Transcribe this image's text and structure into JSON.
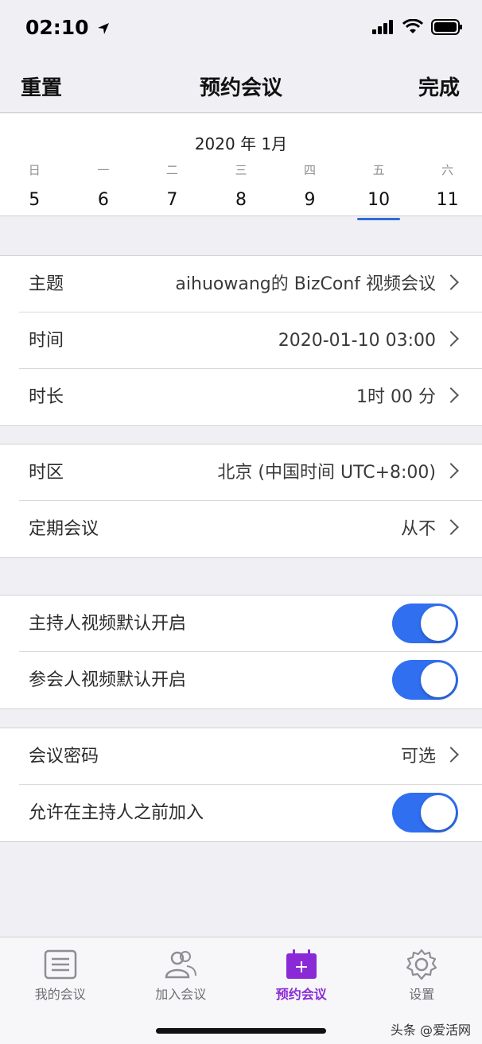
{
  "status": {
    "time": "02:10"
  },
  "nav": {
    "reset": "重置",
    "title": "预约会议",
    "done": "完成"
  },
  "calendar": {
    "month": "2020 年 1月",
    "weekdays": [
      "日",
      "一",
      "二",
      "三",
      "四",
      "五",
      "六"
    ],
    "days": [
      "5",
      "6",
      "7",
      "8",
      "9",
      "10",
      "11"
    ],
    "selected_index": 5
  },
  "settings": {
    "topic_label": "主题",
    "topic_value": "aihuowang的 BizConf 视频会议",
    "time_label": "时间",
    "time_value": "2020-01-10 03:00",
    "duration_label": "时长",
    "duration_value": "1时 00 分",
    "timezone_label": "时区",
    "timezone_value": "北京 (中国时间 UTC+8:00)",
    "recurring_label": "定期会议",
    "recurring_value": "从不",
    "host_video_label": "主持人视频默认开启",
    "participant_video_label": "参会人视频默认开启",
    "password_label": "会议密码",
    "password_value": "可选",
    "join_before_host_label": "允许在主持人之前加入"
  },
  "toggles": {
    "host_video": true,
    "participant_video": true,
    "join_before_host": true
  },
  "colors": {
    "accent": "#2f6ff0",
    "tab_active": "#8a2ad6"
  },
  "tabs": [
    {
      "label": "我的会议",
      "icon": "meeting-list-icon"
    },
    {
      "label": "加入会议",
      "icon": "people-icon"
    },
    {
      "label": "预约会议",
      "icon": "calendar-plus-icon"
    },
    {
      "label": "设置",
      "icon": "gear-icon"
    }
  ],
  "watermark": "头条 @爱活网"
}
